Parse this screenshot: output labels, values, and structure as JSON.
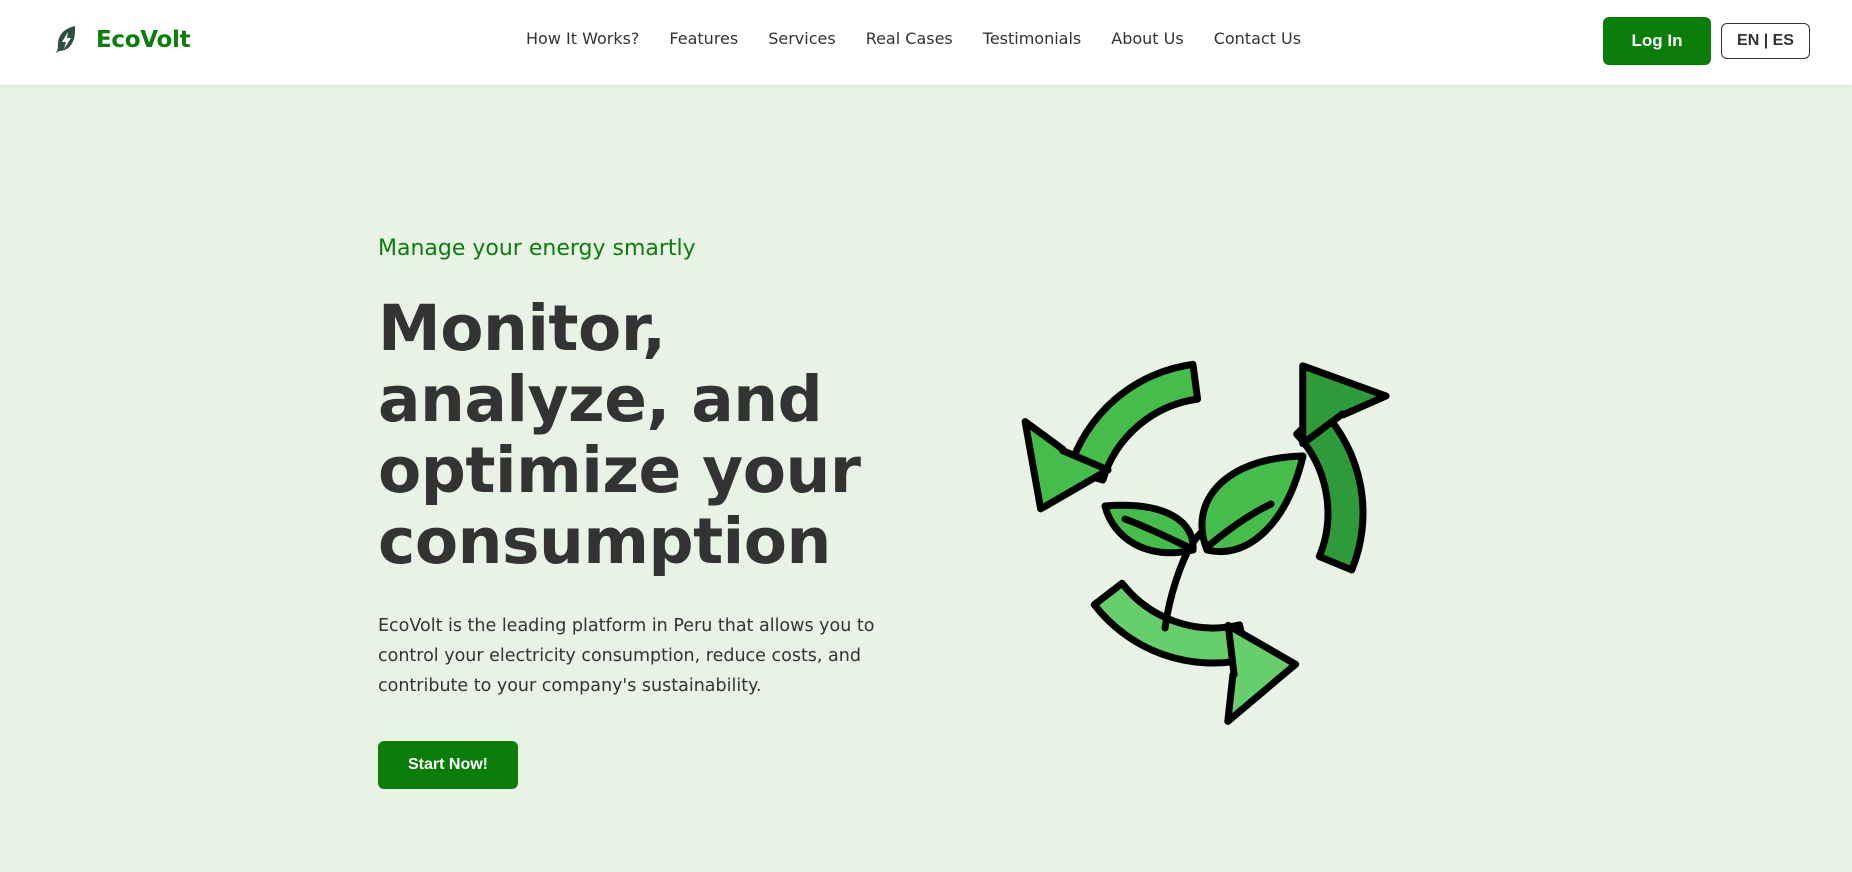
{
  "brand": {
    "name": "EcoVolt",
    "icon": "leaf-bolt-icon",
    "color": "#0a7d0a"
  },
  "nav": {
    "links": [
      "How It Works?",
      "Features",
      "Services",
      "Real Cases",
      "Testimonials",
      "About Us",
      "Contact Us"
    ],
    "login_label": "Log In",
    "language_label": "EN | ES"
  },
  "hero": {
    "tagline": "Manage your energy smartly",
    "headline": "Monitor, analyze, and optimize your consumption",
    "description": "EcoVolt is the leading platform in Peru that allows you to control your electricity consumption, reduce costs, and contribute to your company's sustainability.",
    "cta_label": "Start Now!",
    "illustration": "recycle-arrows-sprout-icon"
  },
  "colors": {
    "accent": "#0a7d0a",
    "background": "#e8f3e6",
    "text": "#333333",
    "arrow_light": "#66cf6b",
    "arrow_mid": "#44bd4b",
    "arrow_dark": "#2e9a3a"
  }
}
